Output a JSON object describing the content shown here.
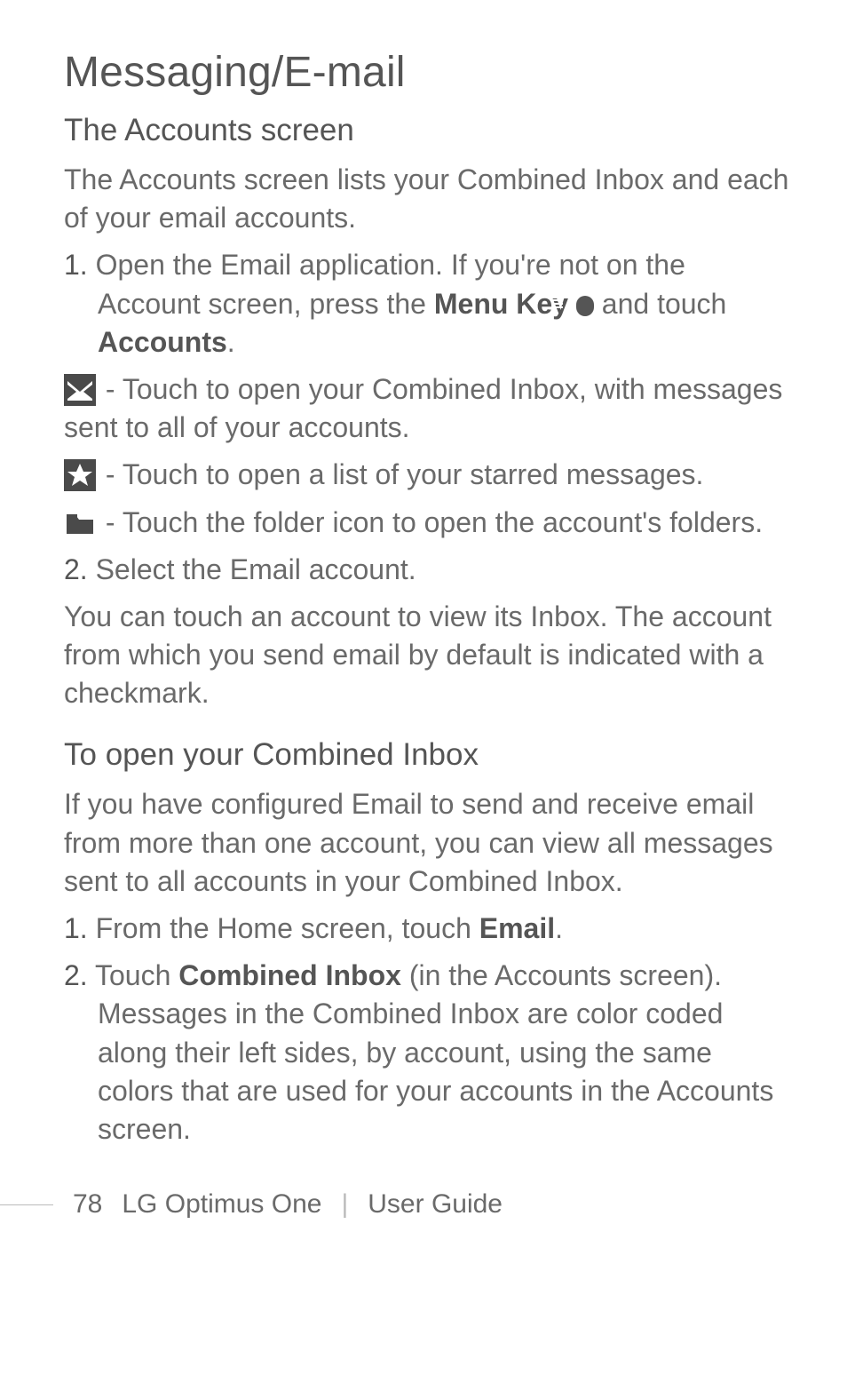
{
  "chapter_title": "Messaging/E-mail",
  "sections": {
    "accounts": {
      "title": "The Accounts screen",
      "intro": "The Accounts screen lists your Combined Inbox and each of your email accounts.",
      "step1_num": "1.",
      "step1_a": " Open the Email application. If you're not on the Account screen, press the ",
      "step1_b": "Menu Key",
      "step1_c": " and touch ",
      "step1_d": "Accounts",
      "step1_e": ".",
      "icon_combined": " - Touch to open your Combined Inbox, with messages sent to all of your accounts.",
      "icon_star": " - Touch to open a list of your starred messages.",
      "icon_folder": " - Touch the folder icon to open the account's folders.",
      "step2_num": "2.",
      "step2_text": "Select the Email account.",
      "outro": "You can touch an account to view its Inbox. The account from which you send email by default is indicated with a checkmark."
    },
    "combined": {
      "title": "To open your Combined Inbox",
      "intro": "If you have configured Email to send and receive email from more than one account, you can view all messages sent to all accounts in your Combined Inbox.",
      "step1_num": "1.",
      "step1_a": " From the Home screen, touch ",
      "step1_b": "Email",
      "step1_c": ".",
      "step2_num": "2.",
      "step2_a": "Touch ",
      "step2_b": "Combined Inbox",
      "step2_c": " (in the Accounts screen). Messages in the Combined Inbox are color coded along their left sides, by account, using the same colors that are used for your accounts in the Accounts screen."
    }
  },
  "footer": {
    "page": "78",
    "doc": "LG Optimus One",
    "sep": "|",
    "guide": "User Guide"
  }
}
